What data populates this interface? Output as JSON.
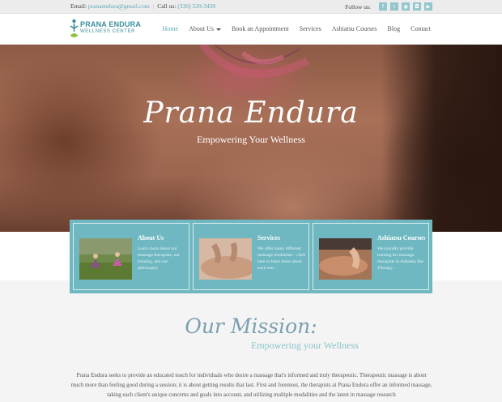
{
  "topbar": {
    "email_label": "Email:",
    "email": "pranaendura@gmail.com",
    "call_label": "Call us:",
    "phone": "(330) 520-3439",
    "follow_label": "Follow us:",
    "social": [
      "facebook-icon",
      "twitter-icon",
      "rss-icon",
      "instagram-icon",
      "youtube-icon"
    ]
  },
  "logo": {
    "line1": "PRANA ENDURA",
    "line2": "WELLNESS CENTER"
  },
  "nav": [
    {
      "label": "Home",
      "active": true
    },
    {
      "label": "About Us",
      "dropdown": true
    },
    {
      "label": "Book an Appointment"
    },
    {
      "label": "Services"
    },
    {
      "label": "Ashiatsu Courses"
    },
    {
      "label": "Blog"
    },
    {
      "label": "Contact"
    }
  ],
  "hero": {
    "title": "Prana Endura",
    "subtitle": "Empowering Your Wellness"
  },
  "cards": [
    {
      "title": "About Us",
      "text": "Learn more about our massage therapists, our training, and our philosophy."
    },
    {
      "title": "Services",
      "text": "We offer many different massage modalities - click here to learn more about each one..."
    },
    {
      "title": "Ashiatsu Courses",
      "text": "We proudly provide training for massage therapists in Ashiatsu Bar Therapy..."
    }
  ],
  "mission": {
    "title": "Our Mission:",
    "subtitle": "Empowering your Wellness",
    "text": "Prana Endura seeks to provide an educated touch for individuals who desire a massage that's informed and truly therapeutic. Therapeutic massage is about much more than feeling good during a session; it is about getting results that last. First and foremost, the therapists at Prana Endura offer an informed massage, taking each client's unique concerns and goals into account, and utilizing multiple modalities and the latest in massage research"
  },
  "colors": {
    "accent": "#5aa9b5",
    "card_bg": "#6fb8c2",
    "logo": "#3a8ea0"
  }
}
